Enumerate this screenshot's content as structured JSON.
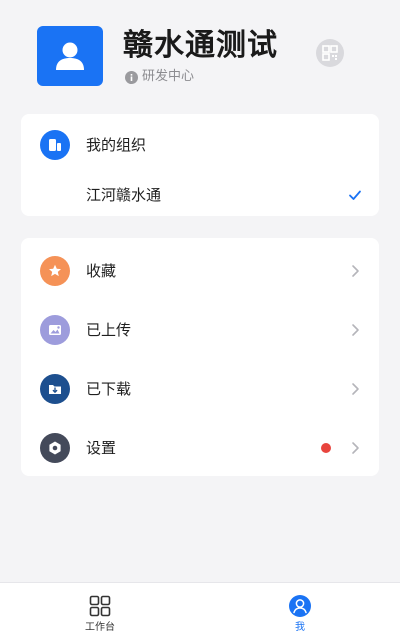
{
  "profile": {
    "name": "赣水通测试",
    "department": "研发中心"
  },
  "organization": {
    "header_label": "我的组织",
    "current_org": "江河赣水通"
  },
  "menu": {
    "items": [
      {
        "label": "收藏",
        "icon": "star-icon",
        "color": "#f59257"
      },
      {
        "label": "已上传",
        "icon": "upload-image-icon",
        "color": "#9d9cdc"
      },
      {
        "label": "已下载",
        "icon": "download-folder-icon",
        "color": "#1d4f8f"
      },
      {
        "label": "设置",
        "icon": "settings-icon",
        "color": "#444a5a",
        "badge": true
      }
    ]
  },
  "tabbar": {
    "tabs": [
      {
        "label": "工作台",
        "icon": "grid-icon",
        "active": false
      },
      {
        "label": "我",
        "icon": "user-icon",
        "active": true
      }
    ]
  },
  "colors": {
    "accent": "#1a73f4",
    "badge": "#e8443d"
  }
}
